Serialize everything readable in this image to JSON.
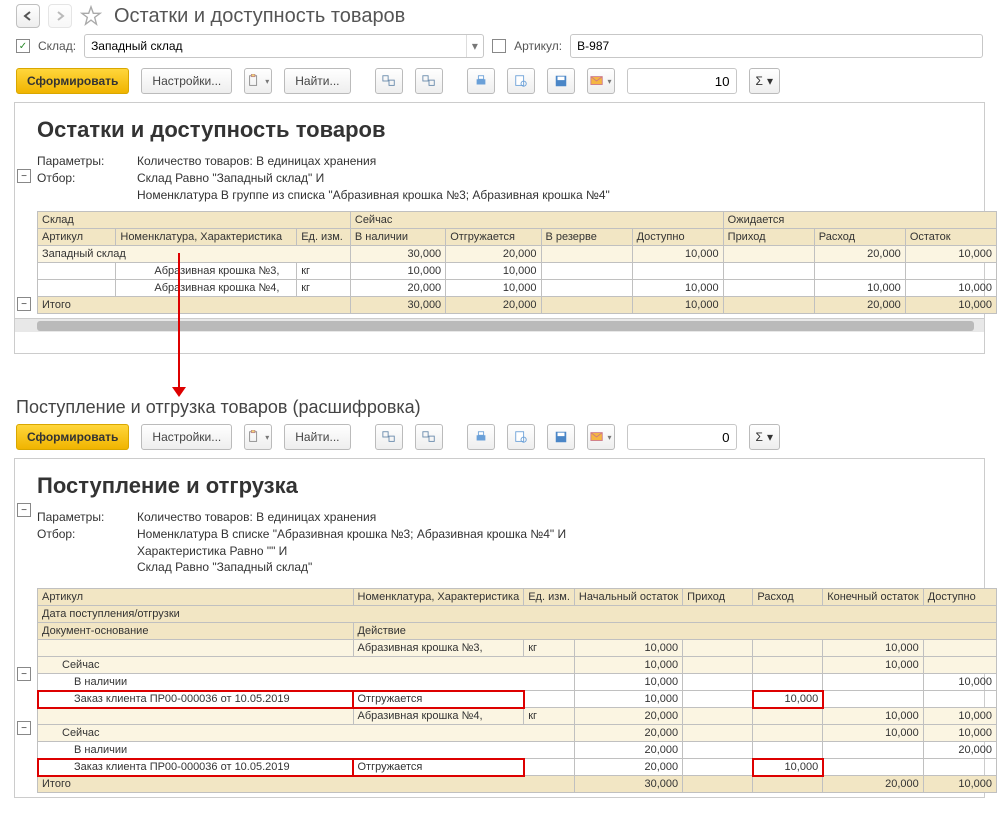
{
  "top": {
    "title": "Остатки и доступность товаров",
    "filter": {
      "warehouse_label": "Склад:",
      "warehouse_value": "Западный склад",
      "sku_label": "Артикул:",
      "sku_value": "B-987"
    }
  },
  "toolbar": {
    "generate": "Сформировать",
    "settings": "Настройки...",
    "find": "Найти...",
    "entries": "10",
    "entries2": "0"
  },
  "report1": {
    "title": "Остатки и доступность товаров",
    "param_lbl": "Параметры:",
    "param_val": "Количество товаров: В единицах хранения",
    "filter_lbl": "Отбор:",
    "filter_val1": "Склад Равно \"Западный склад\" И",
    "filter_val2": "Номенклатура В группе из списка \"Абразивная крошка №3; Абразивная крошка №4\"",
    "hdr": {
      "warehouse": "Склад",
      "now": "Сейчас",
      "expected": "Ожидается",
      "sku": "Артикул",
      "nom": "Номенклатура, Характеристика",
      "unit": "Ед. изм.",
      "instock": "В наличии",
      "shipping": "Отгружается",
      "reserved": "В резерве",
      "avail": "Доступно",
      "incoming": "Приход",
      "outgoing": "Расход",
      "balance": "Остаток"
    },
    "rows": {
      "group": "Западный склад",
      "r1": {
        "nom": "Абразивная крошка №3,",
        "unit": "кг",
        "instock": "10,000",
        "ship": "10,000"
      },
      "r2": {
        "nom": "Абразивная крошка №4,",
        "unit": "кг",
        "instock": "20,000",
        "ship": "10,000",
        "avail": "10,000",
        "out": "10,000",
        "bal": "10,000"
      },
      "sum": {
        "instock": "30,000",
        "ship": "20,000",
        "avail": "10,000",
        "out": "20,000",
        "bal": "10,000"
      },
      "foot": "Итого",
      "tot": {
        "instock": "30,000",
        "ship": "20,000",
        "avail": "10,000",
        "out": "20,000",
        "bal": "10,000"
      }
    }
  },
  "detail_title": "Поступление и отгрузка товаров (расшифровка)",
  "report2": {
    "title": "Поступление и отгрузка",
    "param_lbl": "Параметры:",
    "param_val": "Количество товаров: В единицах хранения",
    "filter_lbl": "Отбор:",
    "filter_val1": "Номенклатура В списке \"Абразивная крошка №3; Абразивная крошка №4\" И",
    "filter_val2": "Характеристика Равно \"\" И",
    "filter_val3": "Склад Равно \"Западный склад\"",
    "hdr": {
      "sku": "Артикул",
      "nom": "Номенклатура, Характеристика",
      "unit": "Ед. изм.",
      "start": "Начальный остаток",
      "in": "Приход",
      "out": "Расход",
      "end": "Конечный остаток",
      "avail": "Доступно",
      "date": "Дата поступления/отгрузки",
      "doc": "Документ-основание",
      "action": "Действие"
    },
    "rows": {
      "nom1": "Абразивная крошка №3,",
      "unit": "кг",
      "now": "Сейчас",
      "instock": "В наличии",
      "order": "Заказ клиента ПР00-000036 от 10.05.2019",
      "act": "Отгружается",
      "nom2": "Абразивная крошка №4,",
      "foot": "Итого",
      "v": {
        "a_start": "10,000",
        "a_end": "10,000",
        "a_now_start": "10,000",
        "a_now_end": "10,000",
        "a_stock_start": "10,000",
        "a_stock_avail": "10,000",
        "a_ord_start": "10,000",
        "a_ord_out": "10,000",
        "b_start": "20,000",
        "b_end": "10,000",
        "b_avail": "10,000",
        "b_now_start": "20,000",
        "b_now_end": "10,000",
        "b_now_avail": "10,000",
        "b_stock_start": "20,000",
        "b_stock_avail": "20,000",
        "b_ord_start": "20,000",
        "b_ord_out": "10,000",
        "t_start": "30,000",
        "t_end": "20,000",
        "t_avail": "10,000"
      }
    }
  }
}
